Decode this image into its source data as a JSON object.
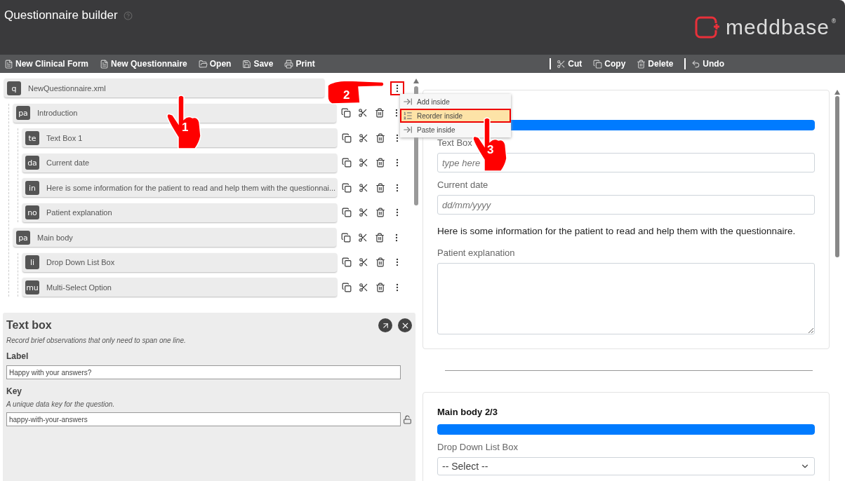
{
  "header": {
    "title": "Questionnaire builder",
    "logo_text": "meddbase",
    "logo_mark": "®"
  },
  "toolbar": {
    "left": [
      "New Clinical Form",
      "New Questionnaire",
      "Open",
      "Save",
      "Print"
    ],
    "right_groups": [
      [
        "Cut",
        "Copy",
        "Delete"
      ],
      [
        "Undo"
      ]
    ]
  },
  "tree": {
    "badge": "q",
    "label": "NewQuestionnaire.xml",
    "highlighted": true,
    "children": [
      {
        "badge": "pa",
        "label": "Introduction",
        "children": [
          {
            "badge": "te",
            "label": "Text Box 1"
          },
          {
            "badge": "da",
            "label": "Current date"
          },
          {
            "badge": "in",
            "label": "Here is some information for the patient to read and help them with the questionnai..."
          },
          {
            "badge": "no",
            "label": "Patient explanation"
          }
        ]
      },
      {
        "badge": "pa",
        "label": "Main body",
        "children": [
          {
            "badge": "li",
            "label": "Drop Down List Box"
          },
          {
            "badge": "mu",
            "label": "Multi-Select Option"
          }
        ]
      }
    ]
  },
  "context_menu": [
    {
      "label": "Add inside",
      "selected": false
    },
    {
      "label": "Reorder inside",
      "selected": true
    },
    {
      "label": "Paste inside",
      "selected": false
    }
  ],
  "callouts": [
    "1",
    "2",
    "3"
  ],
  "properties": {
    "title": "Text box",
    "description": "Record brief observations that only need to span one line.",
    "fields": [
      {
        "label": "Label",
        "value": "Happy with your answers?",
        "locked": false
      },
      {
        "label": "Key",
        "hint": "A unique data key for the question.",
        "value": "happy-with-your-answers",
        "locked": true
      }
    ]
  },
  "preview": {
    "sections": [
      {
        "level": 1,
        "items": [
          {
            "kind": "input",
            "label": "Text Box",
            "placeholder": "type here"
          },
          {
            "kind": "input",
            "label": "Current date",
            "placeholder": "dd/mm/yyyy"
          },
          {
            "kind": "info",
            "text": "Here is some information for the patient to read and help them with the questionnaire."
          },
          {
            "kind": "textarea",
            "label": "Patient explanation"
          }
        ]
      },
      {
        "title": "Main body 2/3",
        "level": 1,
        "items": [
          {
            "kind": "select",
            "label": "Drop Down List Box",
            "value": "-- Select --"
          }
        ]
      }
    ]
  }
}
